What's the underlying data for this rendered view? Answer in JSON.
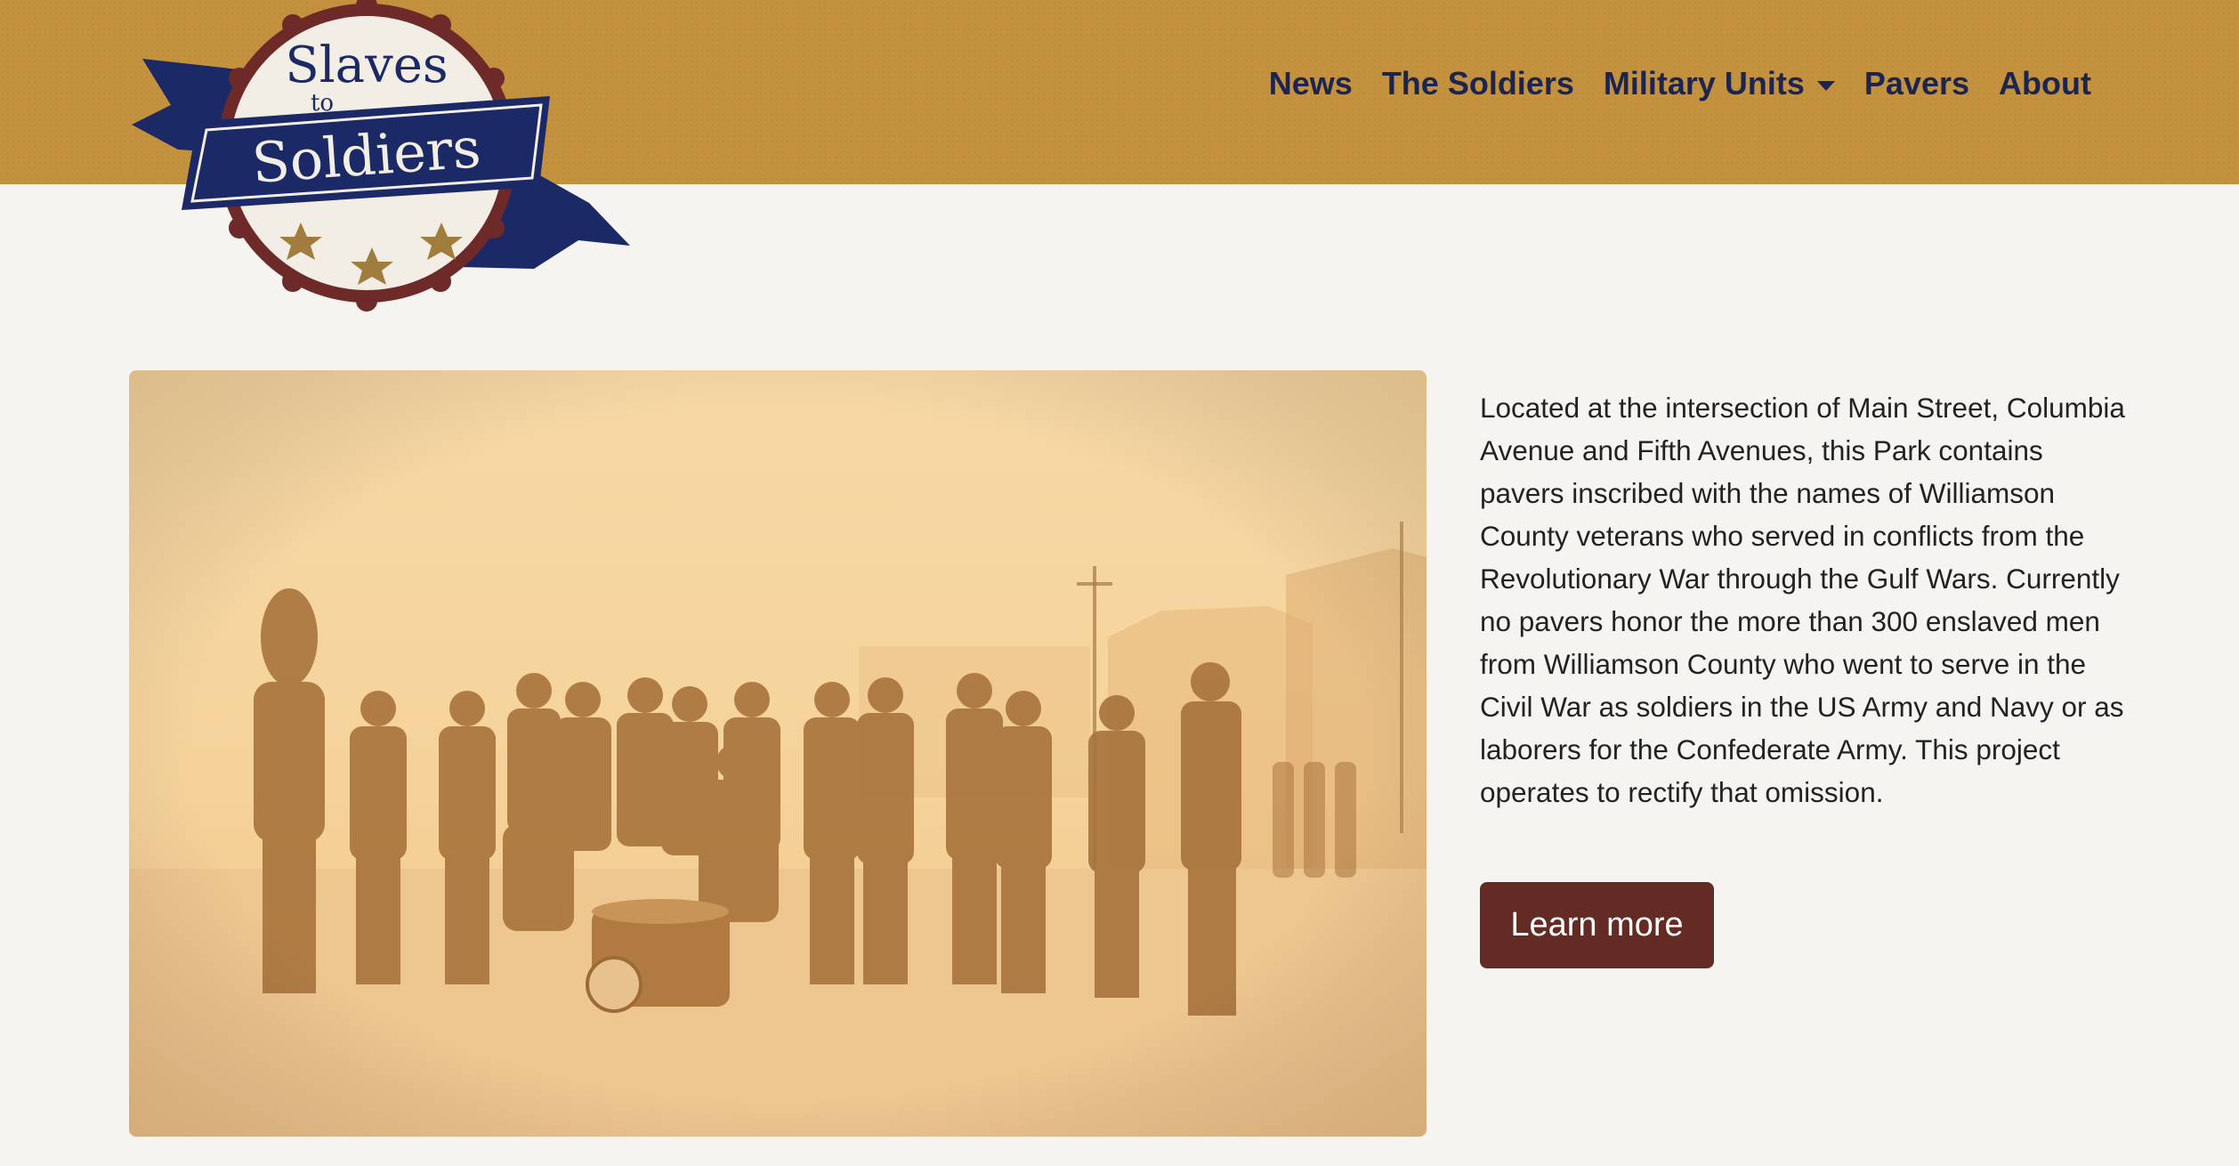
{
  "logo": {
    "line1": "Slaves",
    "line2": "to",
    "line3": "Soldiers",
    "icon": "slaves-to-soldiers-badge-logo"
  },
  "nav": {
    "items": [
      {
        "label": "News"
      },
      {
        "label": "The Soldiers"
      },
      {
        "label": "Military Units",
        "has_dropdown": true
      },
      {
        "label": "Pavers"
      },
      {
        "label": "About"
      }
    ]
  },
  "hero": {
    "photo": "sepia-civil-war-soldiers-group-photo",
    "text": "Located at the intersection of Main Street, Columbia Avenue and Fifth Avenues, this Park contains pavers inscribed with the names of Williamson County veterans who served in conflicts from the Revolutionary War through the Gulf Wars. Currently no pavers honor the more than 300 enslaved men from Williamson County who went to serve in the Civil War as soldiers in the US Army and Navy or as laborers for the Confederate Army. This project operates to rectify that omission.",
    "button_label": "Learn more"
  },
  "colors": {
    "header": "#c4913f",
    "nav_text": "#1c2450",
    "button": "#642a24",
    "background": "#f6f4f0",
    "logo_ribbon": "#1b2a66",
    "logo_ring": "#6e2a28",
    "logo_stars": "#a07d3c"
  }
}
